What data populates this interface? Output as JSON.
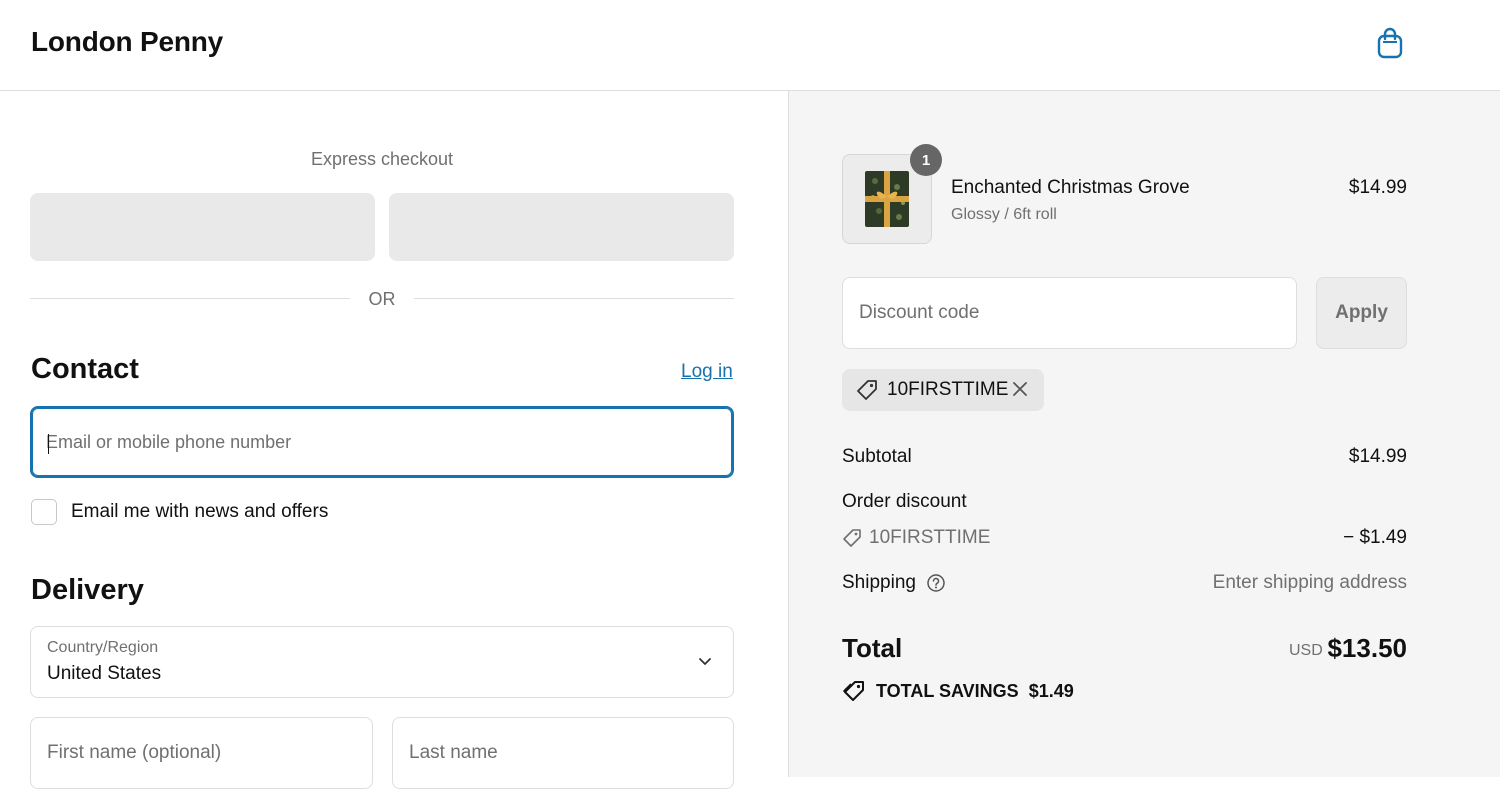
{
  "header": {
    "brand": "London Penny"
  },
  "express": {
    "label": "Express checkout",
    "divider": "OR"
  },
  "contact": {
    "title": "Contact",
    "login_link": "Log in",
    "email_placeholder": "Email or mobile phone number",
    "newsletter_label": "Email me with news and offers"
  },
  "delivery": {
    "title": "Delivery",
    "country_label": "Country/Region",
    "country_value": "United States",
    "first_name_placeholder": "First name (optional)",
    "last_name_placeholder": "Last name"
  },
  "cart": {
    "item": {
      "quantity": "1",
      "name": "Enchanted Christmas Grove",
      "variant": "Glossy / 6ft roll",
      "price": "$14.99"
    },
    "discount_placeholder": "Discount code",
    "apply_label": "Apply",
    "applied_code": "10FIRSTTIME"
  },
  "summary": {
    "subtotal_label": "Subtotal",
    "subtotal_value": "$14.99",
    "order_discount_label": "Order discount",
    "discount_code": "10FIRSTTIME",
    "discount_value": "− $1.49",
    "shipping_label": "Shipping",
    "shipping_value": "Enter shipping address",
    "total_label": "Total",
    "currency": "USD",
    "total_value": "$13.50",
    "savings_label": "TOTAL SAVINGS",
    "savings_value": "$1.49"
  },
  "colors": {
    "accent": "#1773b0",
    "summary_bg": "#f5f5f5",
    "express_button_bg": "#e9e9e9"
  },
  "icons": {
    "bag": "shopping-bag-icon",
    "tag": "tag-icon",
    "close": "close-icon",
    "help": "help-circle-icon",
    "chevron": "chevron-down-icon",
    "savings": "savings-tag-icon"
  }
}
